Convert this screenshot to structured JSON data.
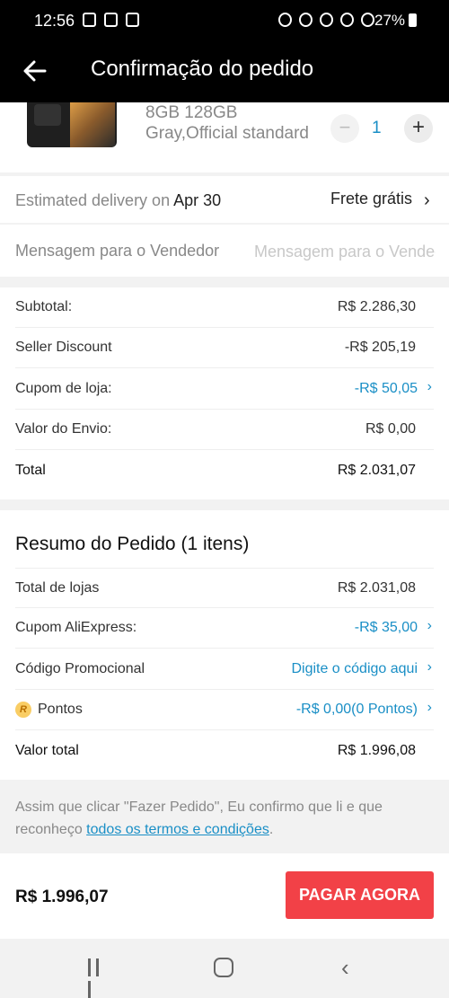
{
  "status_bar": {
    "time": "12:56",
    "battery": "27%"
  },
  "header": {
    "title": "Confirmação do pedido",
    "back_icon": "arrow-left-icon"
  },
  "product": {
    "spec_line1": "8GB 128GB",
    "spec_line2": "Gray,Official standard",
    "quantity": "1",
    "minus": "−",
    "plus": "+"
  },
  "delivery": {
    "label": "Estimated delivery on",
    "date": "Apr 30",
    "shipping": "Frete grátis"
  },
  "message": {
    "label": "Mensagem para o Vendedor",
    "placeholder": "Mensagem para o Vendedor"
  },
  "summary": {
    "rows": [
      {
        "label": "Subtotal:",
        "value": "R$ 2.286,30"
      },
      {
        "label": "Seller Discount",
        "value": "-R$ 205,19"
      },
      {
        "label": "Cupom de loja:",
        "value": "-R$ 50,05"
      },
      {
        "label": "Valor do Envio:",
        "value": "R$ 0,00"
      },
      {
        "label": "Total",
        "value": "R$ 2.031,07"
      }
    ]
  },
  "order_summary": {
    "title": "Resumo do Pedido (1 itens)",
    "rows": [
      {
        "label": "Total de lojas",
        "value": "R$ 2.031,08"
      },
      {
        "label": "Cupom AliExpress:",
        "value": "-R$ 35,00"
      },
      {
        "label": "Código Promocional",
        "value": "Digite o código aqui"
      },
      {
        "label": "Pontos",
        "value": "-R$ 0,00(0 Pontos)",
        "icon_letter": "R"
      },
      {
        "label": "Valor total",
        "value": "R$ 1.996,08"
      }
    ]
  },
  "terms": {
    "text": "Assim que clicar \"Fazer Pedido\", Eu confirmo que li e que reconheço ",
    "link": "todos os termos e condições",
    "suffix": "."
  },
  "footer": {
    "total": "R$ 1.996,07",
    "pay_button": "PAGAR AGORA"
  },
  "colors": {
    "accent_blue": "#1a8fc6",
    "pay_red": "#f24147"
  }
}
